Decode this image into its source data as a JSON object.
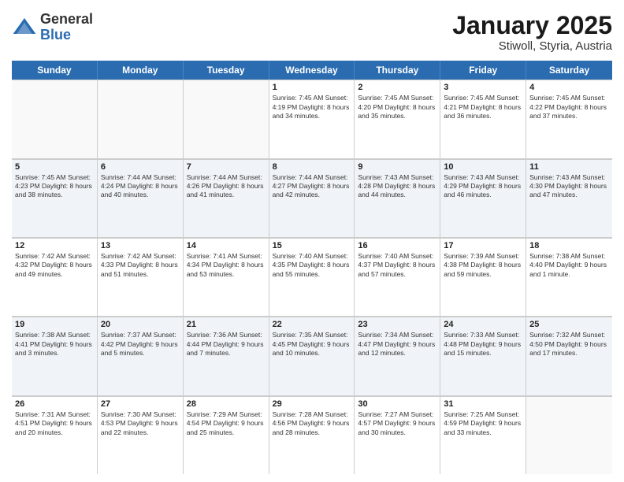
{
  "header": {
    "logo_general": "General",
    "logo_blue": "Blue",
    "title": "January 2025",
    "subtitle": "Stiwoll, Styria, Austria"
  },
  "days_of_week": [
    "Sunday",
    "Monday",
    "Tuesday",
    "Wednesday",
    "Thursday",
    "Friday",
    "Saturday"
  ],
  "weeks": [
    [
      {
        "day": "",
        "empty": true,
        "text": ""
      },
      {
        "day": "",
        "empty": true,
        "text": ""
      },
      {
        "day": "",
        "empty": true,
        "text": ""
      },
      {
        "day": "1",
        "text": "Sunrise: 7:45 AM\nSunset: 4:19 PM\nDaylight: 8 hours\nand 34 minutes."
      },
      {
        "day": "2",
        "text": "Sunrise: 7:45 AM\nSunset: 4:20 PM\nDaylight: 8 hours\nand 35 minutes."
      },
      {
        "day": "3",
        "text": "Sunrise: 7:45 AM\nSunset: 4:21 PM\nDaylight: 8 hours\nand 36 minutes."
      },
      {
        "day": "4",
        "text": "Sunrise: 7:45 AM\nSunset: 4:22 PM\nDaylight: 8 hours\nand 37 minutes."
      }
    ],
    [
      {
        "day": "5",
        "text": "Sunrise: 7:45 AM\nSunset: 4:23 PM\nDaylight: 8 hours\nand 38 minutes."
      },
      {
        "day": "6",
        "text": "Sunrise: 7:44 AM\nSunset: 4:24 PM\nDaylight: 8 hours\nand 40 minutes."
      },
      {
        "day": "7",
        "text": "Sunrise: 7:44 AM\nSunset: 4:26 PM\nDaylight: 8 hours\nand 41 minutes."
      },
      {
        "day": "8",
        "text": "Sunrise: 7:44 AM\nSunset: 4:27 PM\nDaylight: 8 hours\nand 42 minutes."
      },
      {
        "day": "9",
        "text": "Sunrise: 7:43 AM\nSunset: 4:28 PM\nDaylight: 8 hours\nand 44 minutes."
      },
      {
        "day": "10",
        "text": "Sunrise: 7:43 AM\nSunset: 4:29 PM\nDaylight: 8 hours\nand 46 minutes."
      },
      {
        "day": "11",
        "text": "Sunrise: 7:43 AM\nSunset: 4:30 PM\nDaylight: 8 hours\nand 47 minutes."
      }
    ],
    [
      {
        "day": "12",
        "text": "Sunrise: 7:42 AM\nSunset: 4:32 PM\nDaylight: 8 hours\nand 49 minutes."
      },
      {
        "day": "13",
        "text": "Sunrise: 7:42 AM\nSunset: 4:33 PM\nDaylight: 8 hours\nand 51 minutes."
      },
      {
        "day": "14",
        "text": "Sunrise: 7:41 AM\nSunset: 4:34 PM\nDaylight: 8 hours\nand 53 minutes."
      },
      {
        "day": "15",
        "text": "Sunrise: 7:40 AM\nSunset: 4:35 PM\nDaylight: 8 hours\nand 55 minutes."
      },
      {
        "day": "16",
        "text": "Sunrise: 7:40 AM\nSunset: 4:37 PM\nDaylight: 8 hours\nand 57 minutes."
      },
      {
        "day": "17",
        "text": "Sunrise: 7:39 AM\nSunset: 4:38 PM\nDaylight: 8 hours\nand 59 minutes."
      },
      {
        "day": "18",
        "text": "Sunrise: 7:38 AM\nSunset: 4:40 PM\nDaylight: 9 hours\nand 1 minute."
      }
    ],
    [
      {
        "day": "19",
        "text": "Sunrise: 7:38 AM\nSunset: 4:41 PM\nDaylight: 9 hours\nand 3 minutes."
      },
      {
        "day": "20",
        "text": "Sunrise: 7:37 AM\nSunset: 4:42 PM\nDaylight: 9 hours\nand 5 minutes."
      },
      {
        "day": "21",
        "text": "Sunrise: 7:36 AM\nSunset: 4:44 PM\nDaylight: 9 hours\nand 7 minutes."
      },
      {
        "day": "22",
        "text": "Sunrise: 7:35 AM\nSunset: 4:45 PM\nDaylight: 9 hours\nand 10 minutes."
      },
      {
        "day": "23",
        "text": "Sunrise: 7:34 AM\nSunset: 4:47 PM\nDaylight: 9 hours\nand 12 minutes."
      },
      {
        "day": "24",
        "text": "Sunrise: 7:33 AM\nSunset: 4:48 PM\nDaylight: 9 hours\nand 15 minutes."
      },
      {
        "day": "25",
        "text": "Sunrise: 7:32 AM\nSunset: 4:50 PM\nDaylight: 9 hours\nand 17 minutes."
      }
    ],
    [
      {
        "day": "26",
        "text": "Sunrise: 7:31 AM\nSunset: 4:51 PM\nDaylight: 9 hours\nand 20 minutes."
      },
      {
        "day": "27",
        "text": "Sunrise: 7:30 AM\nSunset: 4:53 PM\nDaylight: 9 hours\nand 22 minutes."
      },
      {
        "day": "28",
        "text": "Sunrise: 7:29 AM\nSunset: 4:54 PM\nDaylight: 9 hours\nand 25 minutes."
      },
      {
        "day": "29",
        "text": "Sunrise: 7:28 AM\nSunset: 4:56 PM\nDaylight: 9 hours\nand 28 minutes."
      },
      {
        "day": "30",
        "text": "Sunrise: 7:27 AM\nSunset: 4:57 PM\nDaylight: 9 hours\nand 30 minutes."
      },
      {
        "day": "31",
        "text": "Sunrise: 7:25 AM\nSunset: 4:59 PM\nDaylight: 9 hours\nand 33 minutes."
      },
      {
        "day": "",
        "empty": true,
        "text": ""
      }
    ]
  ]
}
